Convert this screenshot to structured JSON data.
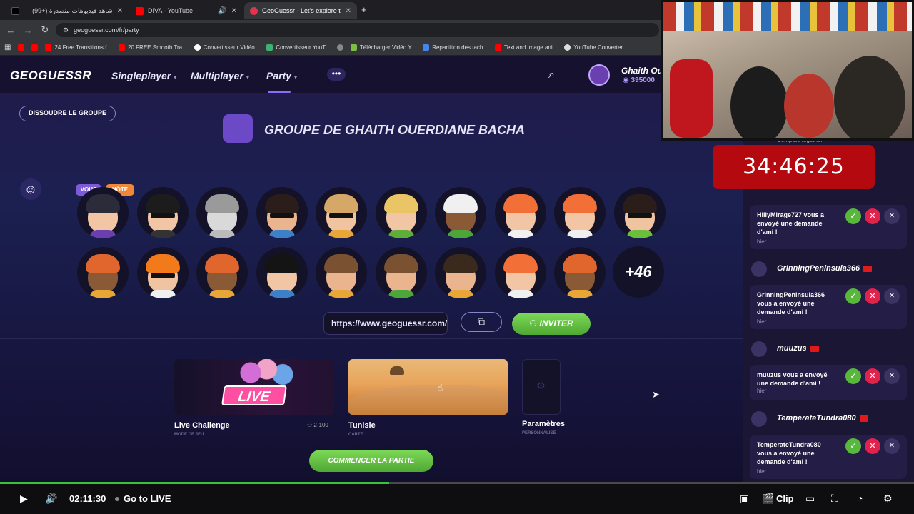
{
  "browser": {
    "tabs": [
      {
        "label": "شاهد فيديوهات متصدرة (+99)",
        "active": false,
        "fav_color": "#ffffff"
      },
      {
        "label": "DIVA - YouTube",
        "active": false,
        "fav_color": "#ff0000"
      },
      {
        "label": "GeoGuessr - Let's explore the w",
        "active": true,
        "fav_color": "#e0334c"
      }
    ],
    "url": "geoguessr.com/fr/party",
    "bookmarks": [
      {
        "label": "",
        "color": "#ff0000"
      },
      {
        "label": "",
        "color": "#ff0000"
      },
      {
        "label": "24 Free Transitions f...",
        "color": "#ff0000"
      },
      {
        "label": "20 FREE Smooth Tra...",
        "color": "#ff0000"
      },
      {
        "label": "Convertisseur Vidéo...",
        "color": "#ffffff"
      },
      {
        "label": "Convertisseur YouT...",
        "color": "#3cb371"
      },
      {
        "label": "",
        "color": "#888888"
      },
      {
        "label": "Télécharger Vidéo Y...",
        "color": "#7bc043"
      },
      {
        "label": "Repartition des tach...",
        "color": "#4285f4"
      },
      {
        "label": "Text and Image ani...",
        "color": "#ff0000"
      },
      {
        "label": "YouTube Converter...",
        "color": "#dddddd"
      }
    ]
  },
  "header": {
    "logo": "GEOGUESSR",
    "menu": [
      "Singleplayer",
      "Multiplayer",
      "Party"
    ],
    "active_menu": "Party",
    "username": "Ghaith Ou",
    "coins": "395000"
  },
  "party": {
    "dissolve_label": "DISSOUDRE LE GROUPE",
    "title": "GROUPE DE GHAITH OUERDIANE BACHA",
    "badge_vous": "VOUS",
    "badge_hote": "HÔTE",
    "more_count": "+46",
    "invite_url": "https://www.geoguessr.com/fr/party/",
    "invite_label": "INVITER",
    "start_label": "COMMENCER LA PARTIE",
    "cards": [
      {
        "name": "Live Challenge",
        "sub": "MODE DE JEU",
        "extra": "2-100",
        "badge": "LIVE"
      },
      {
        "name": "Tunisie",
        "sub": "CARTE"
      },
      {
        "name": "Paramètres",
        "sub": "PERSONNALISÉ"
      }
    ]
  },
  "avatars": [
    {
      "skin": "#f2c6a5",
      "hair": "#2b2b3a",
      "shirt": "#6a3fb0",
      "shades": false
    },
    {
      "skin": "#f2c6a5",
      "hair": "#1c1c1c",
      "shirt": "#333333",
      "shades": true
    },
    {
      "skin": "#d9d9d9",
      "hair": "#9a9a9a",
      "shirt": "#bbbbbb",
      "shades": false
    },
    {
      "skin": "#e9b48e",
      "hair": "#2a1d1a",
      "shirt": "#3c80c8",
      "shades": true
    },
    {
      "skin": "#f0c4a0",
      "hair": "#d6a867",
      "shirt": "#e8a637",
      "shades": true
    },
    {
      "skin": "#f2c6a5",
      "hair": "#e9c565",
      "shirt": "#5fae3a",
      "shades": false
    },
    {
      "skin": "#8a5a36",
      "hair": "#f0f0f0",
      "shirt": "#4da63a",
      "shades": false
    },
    {
      "skin": "#f2c6a5",
      "hair": "#f27038",
      "shirt": "#f0f0f0",
      "shades": false
    },
    {
      "skin": "#f2c6a5",
      "hair": "#f27038",
      "shirt": "#f0f0f0",
      "shades": false
    },
    {
      "skin": "#f0c4a0",
      "hair": "#2a1d1a",
      "shirt": "#6bbf3a",
      "shades": true
    },
    {
      "skin": "#8a5a36",
      "hair": "#e0662d",
      "shirt": "#e8a637",
      "shades": false
    },
    {
      "skin": "#f0c4a0",
      "hair": "#f27a1a",
      "shirt": "#f0f0f0",
      "shades": true
    },
    {
      "skin": "#8a5a36",
      "hair": "#e0662d",
      "shirt": "#e8a637",
      "shades": false
    },
    {
      "skin": "#f2c6a5",
      "hair": "#141414",
      "shirt": "#3c80c8",
      "shades": false
    },
    {
      "skin": "#e9b48e",
      "hair": "#7a5232",
      "shirt": "#e8a637",
      "shades": false
    },
    {
      "skin": "#e9b48e",
      "hair": "#7a5232",
      "shirt": "#4da63a",
      "shades": false
    },
    {
      "skin": "#e9b48e",
      "hair": "#3a2a1d",
      "shirt": "#e8a637",
      "shades": false
    },
    {
      "skin": "#f2c6a5",
      "hair": "#f27038",
      "shirt": "#f0f0f0",
      "shades": false
    },
    {
      "skin": "#8a5a36",
      "hair": "#e0662d",
      "shirt": "#e8a637",
      "shades": false
    }
  ],
  "sidebar": {
    "compete": "Compete together",
    "notifications": [
      {
        "user": "",
        "text": "HillyMirage727 vous a envoyé une demande d'ami !",
        "time": "hier"
      },
      {
        "user": "GrinningPeninsula366",
        "text": "GrinningPeninsula366 vous a envoyé une demande d'ami !",
        "time": "hier"
      },
      {
        "user": "muuzus",
        "text": "muuzus vous a envoyé une demande d'ami !",
        "time": "hier"
      },
      {
        "user": "TemperateTundra080",
        "text": "TemperateTundra080 vous a envoyé une demande d'ami !",
        "time": "hier"
      }
    ]
  },
  "overlay": {
    "timer": "34:46:25"
  },
  "player": {
    "time": "02:11:30",
    "go_live": "Go to LIVE",
    "clip": "Clip",
    "progress": 0.426
  }
}
